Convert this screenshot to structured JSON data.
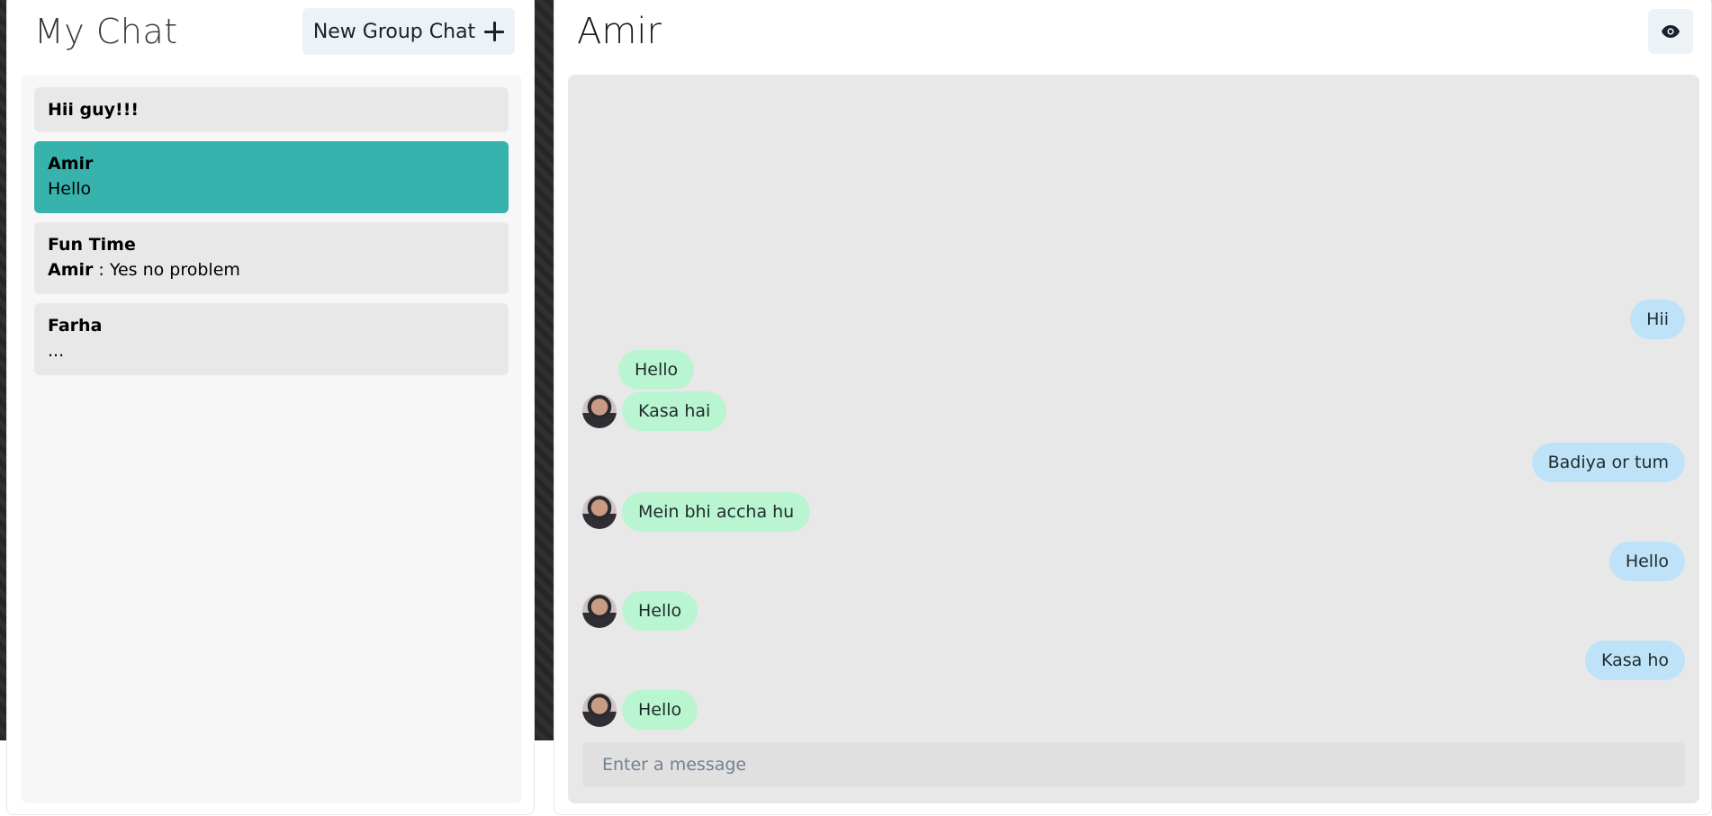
{
  "sidebar": {
    "title": "My Chat",
    "new_group_label": "New Group Chat",
    "chats": [
      {
        "name": "Hii guy!!!",
        "sender": "",
        "preview": ""
      },
      {
        "name": "Amir",
        "sender": "",
        "preview": "Hello"
      },
      {
        "name": "Fun Time",
        "sender": "Amir",
        "preview": " : Yes no problem"
      },
      {
        "name": "Farha",
        "sender": "",
        "preview": "..."
      }
    ]
  },
  "chat": {
    "title": "Amir",
    "view_icon": "eye-icon",
    "messages": [
      {
        "text": "Hii",
        "direction": "sent"
      },
      {
        "text": "Hello",
        "direction": "received"
      },
      {
        "text": "Kasa hai",
        "direction": "received"
      },
      {
        "text": "Badiya or tum",
        "direction": "sent"
      },
      {
        "text": "Mein bhi accha hu",
        "direction": "received"
      },
      {
        "text": "Hello",
        "direction": "sent"
      },
      {
        "text": "Hello",
        "direction": "received"
      },
      {
        "text": "Kasa ho",
        "direction": "sent"
      },
      {
        "text": "Hello",
        "direction": "received"
      }
    ],
    "input_placeholder": "Enter a message",
    "input_value": ""
  },
  "colors": {
    "active_chat": "#38b2ac",
    "sent_bubble": "#bee3f8",
    "received_bubble": "#b9f5d0"
  }
}
